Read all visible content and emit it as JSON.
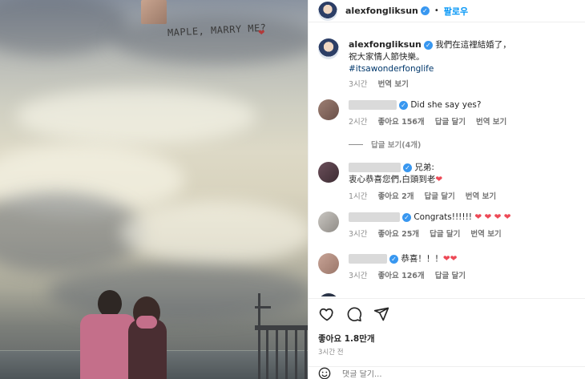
{
  "photo": {
    "banner_text": "MAPLE, MARRY ME?",
    "heart": "❤"
  },
  "header": {
    "username": "alexfongliksun",
    "dot": "•",
    "follow_label": "팔로우"
  },
  "caption": {
    "username": "alexfongliksun",
    "text_line1": "我們在這裡結婚了，",
    "text_line2": "祝大家情人節快樂。",
    "hashtag": "#itsawonderfonglife",
    "time": "3시간",
    "translate": "번역 보기"
  },
  "comments": [
    {
      "text": "Did she say yes?",
      "time": "2시간",
      "likes": "좋아요 156개",
      "reply": "답글 달기",
      "translate": "번역 보기"
    },
    {
      "text_line1": "兄弟:",
      "text_line2": "衷心恭喜您們,白頭到老",
      "heart": "❤",
      "time": "1시간",
      "likes": "좋아요 2개",
      "reply": "답글 달기",
      "translate": "번역 보기"
    },
    {
      "text": "Congrats!!!!!!",
      "hearts": "❤ ❤ ❤ ❤",
      "time": "3시간",
      "likes": "좋아요 25개",
      "reply": "답글 달기",
      "translate": "번역 보기"
    },
    {
      "text": "恭喜！！！",
      "hearts": "❤❤",
      "time": "3시간",
      "likes": "좋아요 126개",
      "reply": "답글 달기"
    }
  ],
  "view_replies": "답글 보기(4개)",
  "footer": {
    "likes": "좋아요 1.8만개",
    "time": "3시간 전",
    "add_comment_placeholder": "댓글 달기..."
  },
  "icons": [
    "heart-icon",
    "comment-icon",
    "share-icon",
    "emoji-icon",
    "verified-icon"
  ],
  "colors": {
    "link": "#0095f6",
    "verified": "#3897f0",
    "heart": "#ed4956",
    "muted": "#8e8e8e"
  }
}
